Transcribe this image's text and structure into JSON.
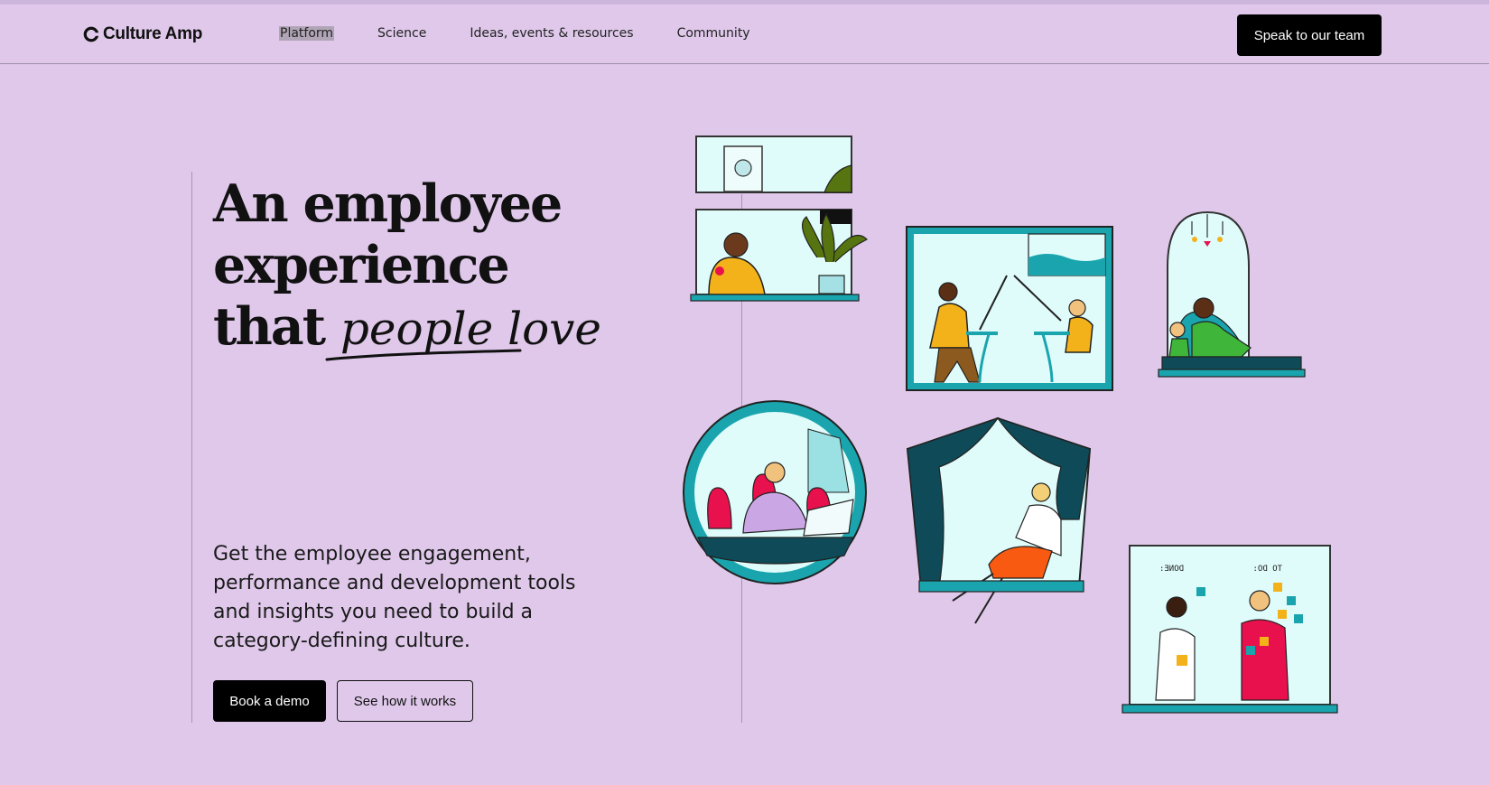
{
  "brand": {
    "name": "Culture Amp"
  },
  "nav": {
    "items": [
      {
        "label": "Platform"
      },
      {
        "label": "Science"
      },
      {
        "label": "Ideas, events & resources"
      },
      {
        "label": "Community"
      }
    ],
    "cta_label": "Speak to our team"
  },
  "hero": {
    "headline_line1": "An employee",
    "headline_line2": "experience",
    "headline_line3": "that",
    "headline_script": "people love",
    "subtitle": "Get the employee engagement, performance and development tools and insights you need to build a category-defining culture.",
    "primary_button": "Book a demo",
    "secondary_button": "See how it works"
  },
  "illustration": {
    "note_left": "DONE:",
    "note_right": "TO DO:"
  },
  "colors": {
    "background": "#dfc8ea",
    "teal": "#1aa5ae",
    "dark_teal": "#0e4a57",
    "sky": "#dffcfb",
    "yellow": "#f3b21a",
    "pink": "#e8114d",
    "button": "#000000"
  }
}
